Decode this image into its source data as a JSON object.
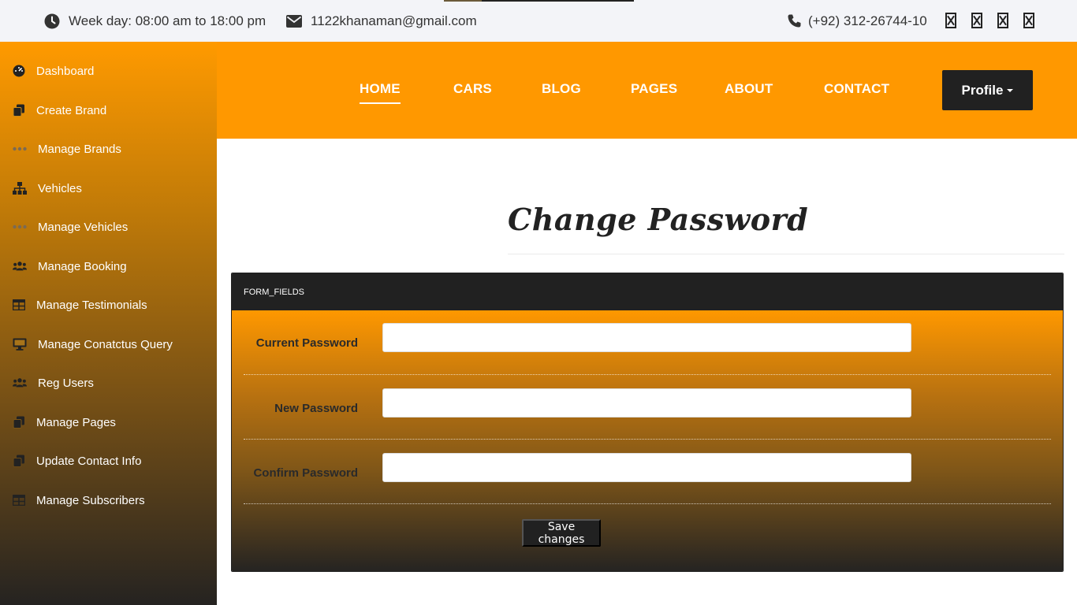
{
  "topbar": {
    "hours_text": "Week day: 08:00 am to 18:00 pm",
    "email_text": "1122khanaman@gmail.com",
    "phone_text": "(+92) 312-26744-10",
    "social_icons": [
      "social-icon-1",
      "social-icon-2",
      "social-icon-3",
      "social-icon-4"
    ]
  },
  "sidebar": {
    "items": [
      {
        "label": "Dashboard",
        "icon": "dashboard-icon"
      },
      {
        "label": "Create Brand",
        "icon": "copy-icon"
      },
      {
        "label": "Manage Brands",
        "icon": "ellipsis-icon"
      },
      {
        "label": "Vehicles",
        "icon": "sitemap-icon"
      },
      {
        "label": "Manage Vehicles",
        "icon": "ellipsis-icon"
      },
      {
        "label": "Manage Booking",
        "icon": "users-icon"
      },
      {
        "label": "Manage Testimonials",
        "icon": "table-icon"
      },
      {
        "label": "Manage Conatctus Query",
        "icon": "desktop-icon"
      },
      {
        "label": "Reg Users",
        "icon": "users-icon"
      },
      {
        "label": "Manage Pages",
        "icon": "copy-icon"
      },
      {
        "label": "Update Contact Info",
        "icon": "copy-icon"
      },
      {
        "label": "Manage Subscribers",
        "icon": "table-icon"
      }
    ]
  },
  "nav": {
    "links": [
      "HOME",
      "CARS",
      "BLOG",
      "PAGES",
      "ABOUT",
      "CONTACT"
    ],
    "active": "HOME",
    "profile_label": "Profile"
  },
  "main": {
    "title": "Change Password",
    "panel_heading": "FORM_FIELDS",
    "fields": [
      {
        "label": "Current Password",
        "value": ""
      },
      {
        "label": "New Password",
        "value": ""
      },
      {
        "label": "Confirm Password",
        "value": ""
      }
    ],
    "submit_label": "Save changes"
  },
  "colors": {
    "accent": "#ff9800",
    "dark": "#212121",
    "topbar_bg": "#f3f4f8"
  }
}
